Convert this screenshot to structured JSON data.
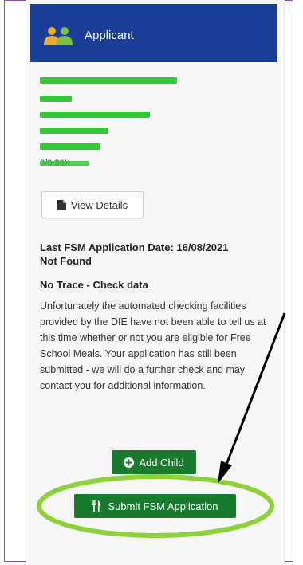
{
  "header": {
    "title": "Applicant",
    "icon": "people-icon"
  },
  "applicant": {
    "postcode_partial": "0/0 30X"
  },
  "buttons": {
    "view_details": "View Details",
    "add_child": "Add Child",
    "submit": "Submit FSM Application"
  },
  "status": {
    "last_application": "Last FSM Application Date: 16/08/2021",
    "not_found": "Not Found",
    "no_trace": "No Trace - Check data",
    "message": "Unfortunately the automated checking facilities provided by the DfE have not been able to tell us at this time whether or not you are eligible for Free School Meals. Your application has still been submitted - we will do a further check and may contact you for additional information."
  },
  "colors": {
    "header_bg": "#1b3f96",
    "button_green": "#187a2c",
    "highlight_circle": "#8fd13a",
    "redaction": "#35c73a",
    "frame": "#8f4fa6"
  }
}
